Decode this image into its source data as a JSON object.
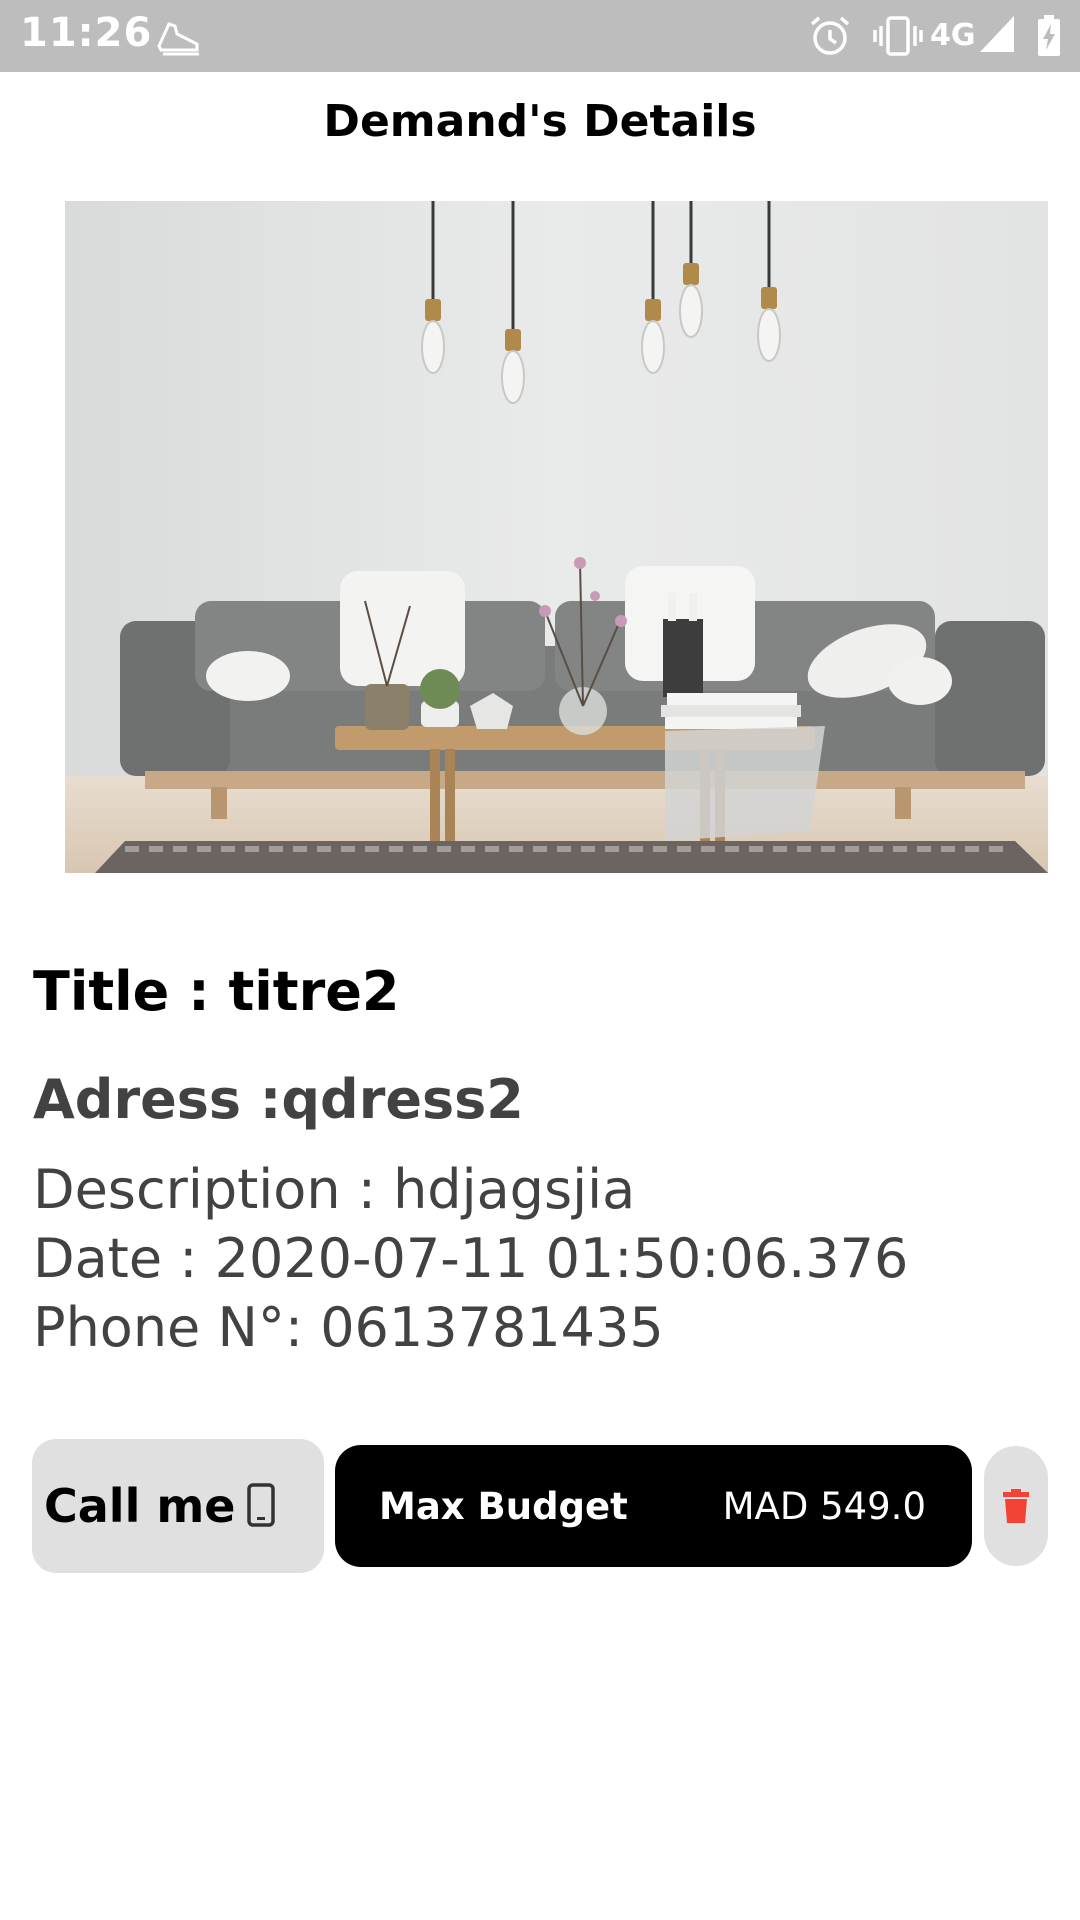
{
  "status_bar": {
    "time": "11:26",
    "network": "4G",
    "icons": [
      "shoe-icon",
      "alarm-icon",
      "vibrate-icon",
      "signal-icon",
      "battery-charging-icon"
    ]
  },
  "app_bar": {
    "title": "Demand's Details"
  },
  "demand": {
    "image": "living-room-photo",
    "title_text": "Title : titre2",
    "address_text": "Adress :qdress2",
    "description_text": "Description : hdjagsjia",
    "date_text": "Date : 2020-07-11 01:50:06.376",
    "phone_text": "Phone N°: 0613781435"
  },
  "actions": {
    "call_label": "Call me",
    "call_icon": "smartphone-icon",
    "budget_label": "Max Budget",
    "budget_value": "MAD 549.0",
    "delete_icon": "trash-icon"
  },
  "colors": {
    "status_bar": "#bdbdbd",
    "button_bg": "#e0e0e0",
    "budget_bg": "#000000",
    "delete_red": "#f44336"
  }
}
